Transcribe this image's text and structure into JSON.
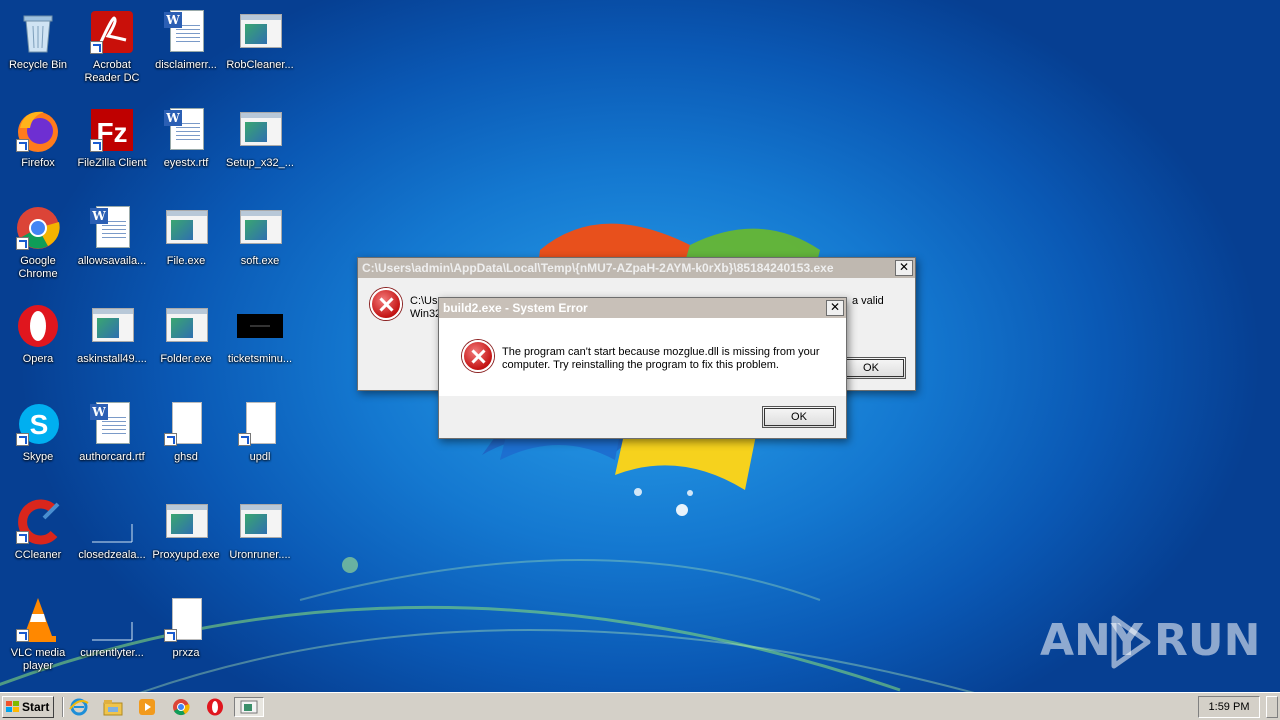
{
  "desktop": {
    "icons": [
      {
        "label": "Recycle Bin"
      },
      {
        "label": "Acrobat Reader DC"
      },
      {
        "label": "disclaimerr..."
      },
      {
        "label": "RobCleaner..."
      },
      {
        "label": "Firefox"
      },
      {
        "label": "FileZilla Client"
      },
      {
        "label": "eyestx.rtf"
      },
      {
        "label": "Setup_x32_..."
      },
      {
        "label": "Google Chrome"
      },
      {
        "label": "allowsavaila..."
      },
      {
        "label": "File.exe"
      },
      {
        "label": "soft.exe"
      },
      {
        "label": "Opera"
      },
      {
        "label": "askinstall49...."
      },
      {
        "label": "Folder.exe"
      },
      {
        "label": "ticketsminu..."
      },
      {
        "label": "Skype"
      },
      {
        "label": "authorcard.rtf"
      },
      {
        "label": "ghsd"
      },
      {
        "label": "updl"
      },
      {
        "label": "CCleaner"
      },
      {
        "label": "closedzeala..."
      },
      {
        "label": "Proxyupd.exe"
      },
      {
        "label": "Uronruner...."
      },
      {
        "label": "VLC media player"
      },
      {
        "label": "currentlyter..."
      },
      {
        "label": "prxza"
      }
    ]
  },
  "dialog_back": {
    "title": "C:\\Users\\admin\\AppData\\Local\\Temp\\{nMU7-AZpaH-2AYM-k0rXb}\\85184240153.exe",
    "line1_start": "C:\\Us",
    "line1_end": "a valid",
    "line2_start": "Win32",
    "ok_label": "OK"
  },
  "dialog_front": {
    "title": "build2.exe - System Error",
    "message_line1": "The program can't start because mozglue.dll is missing from your",
    "message_line2": "computer. Try reinstalling the program to fix this problem.",
    "ok_label": "OK"
  },
  "taskbar": {
    "start_label": "Start",
    "clock": "1:59 PM"
  },
  "watermark": {
    "left_text": "ANY",
    "right_text": "RUN"
  }
}
